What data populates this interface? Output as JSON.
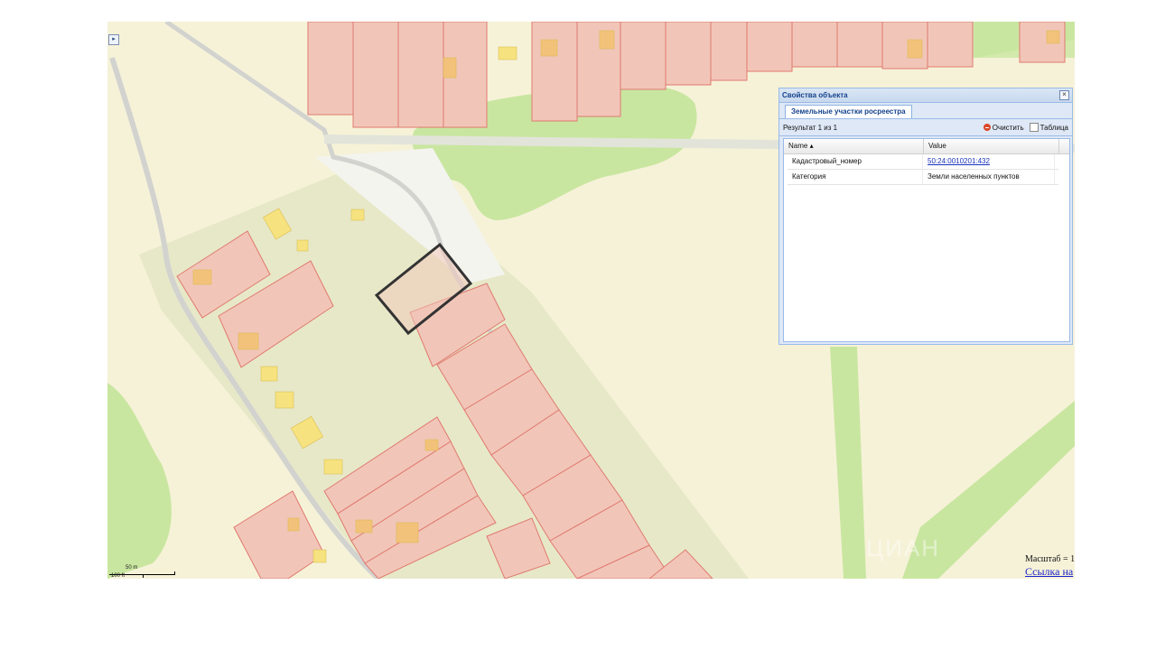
{
  "map": {
    "expand_icon": "expand-arrow-icon",
    "scale_bar": {
      "metric_label": "50 m",
      "imperial_label": "100 ft"
    },
    "info": {
      "scale_text": "Масштаб = 1",
      "link_text": "Ссылка на"
    },
    "watermark": "ЦИАН",
    "colors": {
      "background": "#f6f2d8",
      "parcel_fill": "#f1c6b8",
      "parcel_border": "#e07a70",
      "vegetation": "#c9e6a0",
      "building": "#f6e27e",
      "selected_border": "#333333"
    }
  },
  "panel": {
    "title": "Свойства объекта",
    "close_icon": "close-icon",
    "tab": "Земельные участки росреестра",
    "result_text": "Результат 1 из 1",
    "clear_label": "Очистить",
    "table_label": "Таблица",
    "columns": [
      "Name ▴",
      "Value"
    ],
    "rows": [
      {
        "name": "Кадастровый_номер",
        "value": "50:24:0010201:432"
      },
      {
        "name": "Категория",
        "value": "Земли населенных пунктов"
      }
    ]
  }
}
